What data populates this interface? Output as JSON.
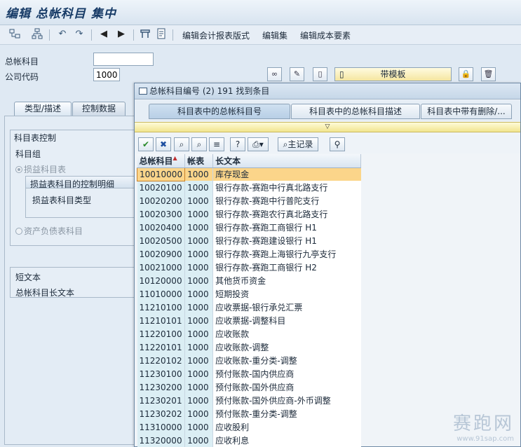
{
  "window": {
    "title": "编辑 总帐科目 集中"
  },
  "toolbar": {
    "icons": [
      "hierarchy-icon",
      "tree-icon",
      "undo-icon",
      "redo-icon",
      "prev-icon",
      "next-icon",
      "layout-icon",
      "document-icon"
    ],
    "menu_items": [
      "编辑会计报表版式",
      "编辑集",
      "编辑成本要素"
    ]
  },
  "form": {
    "gl_account_label": "总帐科目",
    "gl_account_value": "",
    "company_code_label": "公司代码",
    "company_code_value": "1000",
    "template_button": "带模板"
  },
  "tabs": [
    "类型/描述",
    "控制数据"
  ],
  "sections": {
    "coa_control": "科目表控制",
    "account_group": "科目组",
    "pl_account": "损益科目表",
    "pl_control_detail": "损益表科目的控制明细",
    "pl_account_type": "损益表科目类型",
    "bs_account": "资产负债表科目",
    "short_text": "短文本",
    "long_text": "总帐科目长文本"
  },
  "popup": {
    "title": "总帐科目编号 (2)  191 找到条目",
    "tabs": [
      "科目表中的总帐科目号",
      "科目表中的总帐科目描述",
      "科目表中带有删除/..."
    ],
    "strip_symbol": "▽",
    "toolbar_buttons": {
      "confirm": "✔",
      "cancel": "✖",
      "master_record": "主记录"
    },
    "columns": [
      "总帐科目",
      "帐表",
      "长文本"
    ],
    "rows": [
      [
        "10010000",
        "1000",
        "库存现金"
      ],
      [
        "10020100",
        "1000",
        "银行存款-赛跑中行真北路支行"
      ],
      [
        "10020200",
        "1000",
        "银行存款-赛跑中行普陀支行"
      ],
      [
        "10020300",
        "1000",
        "银行存款-赛跑农行真北路支行"
      ],
      [
        "10020400",
        "1000",
        "银行存款-赛跑工商银行 H1"
      ],
      [
        "10020500",
        "1000",
        "银行存款-赛跑建设银行 H1"
      ],
      [
        "10020900",
        "1000",
        "银行存款-赛跑上海银行九亭支行"
      ],
      [
        "10021000",
        "1000",
        "银行存款-赛跑工商银行 H2"
      ],
      [
        "10120000",
        "1000",
        "其他货币资金"
      ],
      [
        "11010000",
        "1000",
        "短期投资"
      ],
      [
        "11210100",
        "1000",
        "应收票据-银行承兑汇票"
      ],
      [
        "11210101",
        "1000",
        "应收票据-调整科目"
      ],
      [
        "11220100",
        "1000",
        "应收账款"
      ],
      [
        "11220101",
        "1000",
        "应收账款-调整"
      ],
      [
        "11220102",
        "1000",
        "应收账款-重分类-调整"
      ],
      [
        "11230100",
        "1000",
        "预付账款-国内供应商"
      ],
      [
        "11230200",
        "1000",
        "预付账款-国外供应商"
      ],
      [
        "11230201",
        "1000",
        "预付账款-国外供应商-外币调整"
      ],
      [
        "11230202",
        "1000",
        "预付账款-重分类-调整"
      ],
      [
        "11310000",
        "1000",
        "应收股利"
      ],
      [
        "11320000",
        "1000",
        "应收利息"
      ]
    ]
  },
  "watermark": {
    "brand": "赛跑网",
    "url": "www.91sap.com"
  }
}
